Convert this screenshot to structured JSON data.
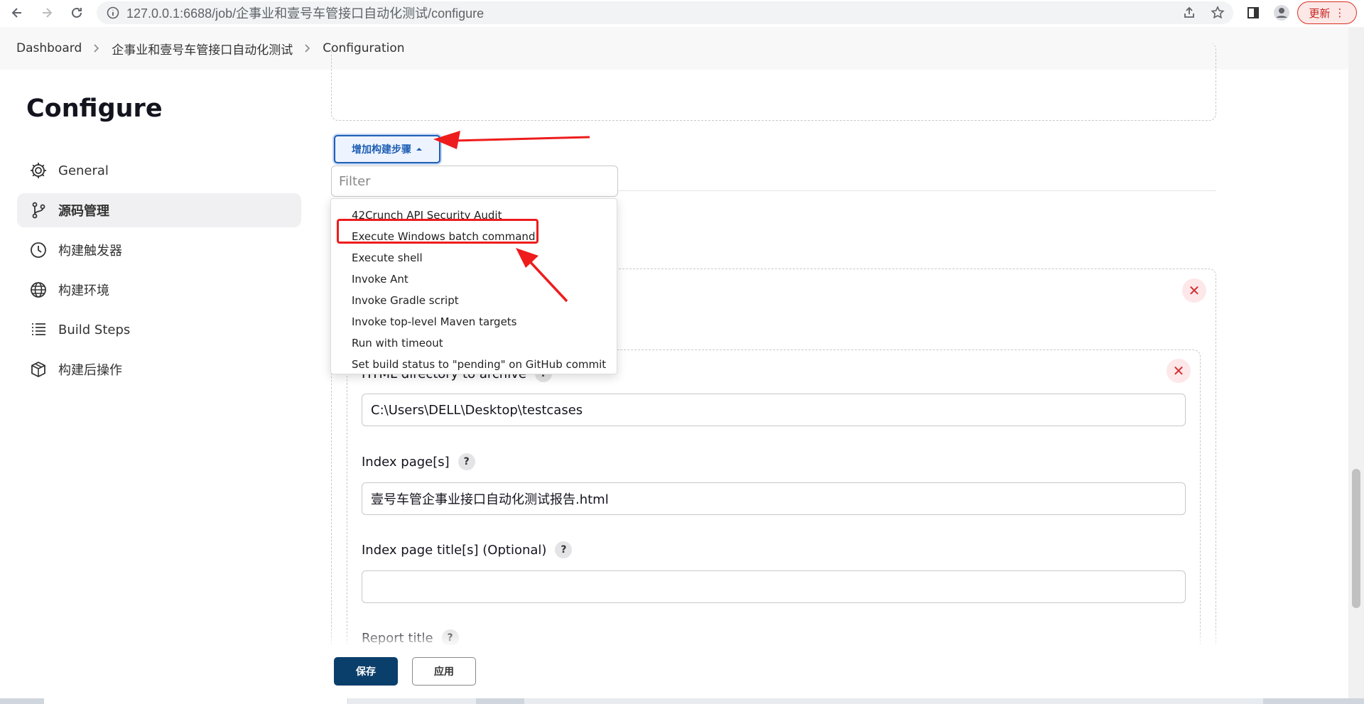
{
  "browser": {
    "url": "127.0.0.1:6688/job/企事业和壹号车管接口自动化测试/configure",
    "update_label": "更新"
  },
  "breadcrumb": {
    "items": [
      "Dashboard",
      "企事业和壹号车管接口自动化测试",
      "Configuration"
    ]
  },
  "sidebar": {
    "title": "Configure",
    "items": [
      {
        "label": "General",
        "icon": "gear-icon"
      },
      {
        "label": "源码管理",
        "icon": "branch-icon",
        "active": true
      },
      {
        "label": "构建触发器",
        "icon": "clock-icon"
      },
      {
        "label": "构建环境",
        "icon": "globe-icon"
      },
      {
        "label": "Build Steps",
        "icon": "list-icon"
      },
      {
        "label": "构建后操作",
        "icon": "package-icon"
      }
    ]
  },
  "main": {
    "add_build_step_label": "增加构建步骤",
    "filter_placeholder": "Filter",
    "dropdown_items": [
      "42Crunch API Security Audit",
      "Execute Windows batch command",
      "Execute shell",
      "Invoke Ant",
      "Invoke Gradle script",
      "Invoke top-level Maven targets",
      "Run with timeout",
      "Set build status to \"pending\" on GitHub commit"
    ],
    "html_dir_label": "HTML directory to archive",
    "html_dir_value": "C:\\Users\\DELL\\Desktop\\testcases",
    "index_pages_label": "Index page[s]",
    "index_pages_value": "壹号车管企事业接口自动化测试报告.html",
    "index_title_label": "Index page title[s] (Optional)",
    "index_title_value": "",
    "report_title_label": "Report title",
    "help_glyph": "?"
  },
  "footer": {
    "save_label": "保存",
    "apply_label": "应用"
  },
  "colors": {
    "accent": "#1e5fb4",
    "save_bg": "#0b3f6b",
    "annotation_red": "#ee1c1c"
  }
}
